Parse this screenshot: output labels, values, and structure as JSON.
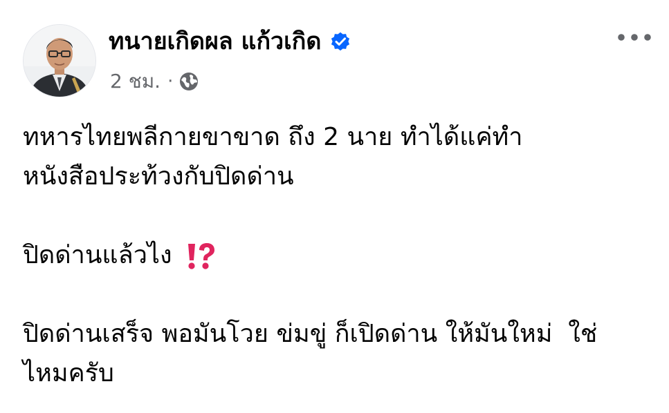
{
  "post": {
    "author": {
      "name": "ทนายเกิดผล แก้วเกิด",
      "verified_icon": "verified-badge-icon",
      "avatar_icon": "profile-photo"
    },
    "meta": {
      "timestamp": "2 ชม.",
      "separator": "·",
      "audience_icon": "globe-icon"
    },
    "more_icon": "more-options-icon",
    "paragraphs": [
      {
        "lines": [
          "ทหารไทยพลีกายขาขาด ถึง 2 นาย ทำได้แค่ทำ",
          "หนังสือประท้วงกับปิดด่าน"
        ]
      },
      {
        "lines": [
          "ปิดด่านแล้วไง"
        ],
        "emoji": "exclamation-question-mark-icon"
      },
      {
        "lines": [
          "ปิดด่านเสร็จ พอมันโวย ข่มขู่ ก็เปิดด่าน ให้มันใหม่  ใช่",
          "ไหมครับ"
        ]
      }
    ]
  },
  "colors": {
    "text_primary": "#050505",
    "text_secondary": "#65676b",
    "verified_blue": "#0866ff",
    "emoji_red": "#e0245e"
  }
}
